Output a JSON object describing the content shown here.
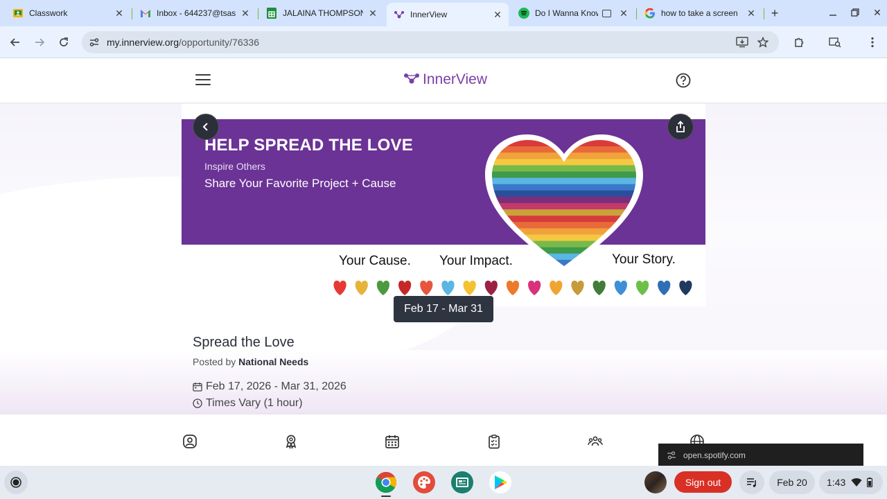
{
  "browser": {
    "tabs": [
      {
        "label": "Classwork",
        "icon": "google-classroom-icon",
        "active": false
      },
      {
        "label": "Inbox - 644237@tsas",
        "icon": "gmail-icon",
        "active": false
      },
      {
        "label": "JALAINA THOMPSON",
        "icon": "google-sheets-icon",
        "active": false
      },
      {
        "label": "InnerView",
        "icon": "innerview-icon",
        "active": true
      },
      {
        "label": "Do I Wanna Know",
        "icon": "spotify-icon",
        "active": false
      },
      {
        "label": "how to take a screen",
        "icon": "google-icon",
        "active": false
      }
    ],
    "url_host": "my.innerview.org",
    "url_path": "/opportunity/76336"
  },
  "app": {
    "brand": "InnerView"
  },
  "banner": {
    "title": "HELP SPREAD THE LOVE",
    "subtitle1": "Inspire Others",
    "subtitle2": "Share Your Favorite Project + Cause",
    "tag_cause": "Your Cause.",
    "tag_impact": "Your Impact.",
    "tag_story": "Your Story.",
    "stripe_colors": [
      "#d83b3b",
      "#e86a3a",
      "#f1a23b",
      "#f4c842",
      "#79b94a",
      "#3f9a4a",
      "#5bb6e3",
      "#3a78c9",
      "#2b4e9b",
      "#7a2f7d",
      "#c33a6b",
      "#c9a23a"
    ],
    "heart_colors": [
      "#e53935",
      "#e5b43b",
      "#4c9a3f",
      "#c62828",
      "#e8553f",
      "#5bb6e3",
      "#f2c230",
      "#9b2242",
      "#ec7a2a",
      "#d9327a",
      "#f0a531",
      "#c79b39",
      "#3f7d39",
      "#3f8fd6",
      "#6cc04a",
      "#2e6fb5",
      "#22395f"
    ]
  },
  "date_chip": "Feb 17 - Mar 31",
  "opportunity": {
    "title": "Spread the Love",
    "posted_by_label": "Posted by",
    "posted_by": "National Needs",
    "dates": "Feb 17, 2026 - Mar 31, 2026",
    "times": "Times Vary (1 hour)"
  },
  "bottom_nav": [
    "profile-icon",
    "award-icon",
    "calendar-icon",
    "clipboard-icon",
    "community-icon",
    "globe-icon"
  ],
  "toast": {
    "text": "open.spotify.com"
  },
  "shelf": {
    "apps": [
      "chrome-icon",
      "canvas-icon",
      "classroom-icon",
      "play-store-icon"
    ],
    "sign_out": "Sign out",
    "date": "Feb 20",
    "time": "1:43"
  },
  "colors": {
    "brand_purple": "#7b3fa8",
    "banner_purple": "#6b3395",
    "sign_out_red": "#d93025"
  }
}
